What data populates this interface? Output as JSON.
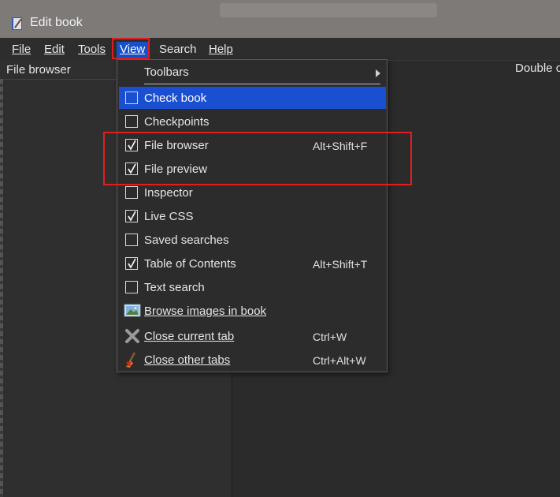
{
  "window": {
    "title": "Edit book"
  },
  "menubar": {
    "file": "File",
    "edit": "Edit",
    "tools": "Tools",
    "view": "View",
    "search": "Search",
    "help": "Help"
  },
  "panels": {
    "left_title": "File browser",
    "right_title": "Double c"
  },
  "view_menu": {
    "toolbars": "Toolbars",
    "items": [
      {
        "label": "Check book",
        "checked": false,
        "shortcut": ""
      },
      {
        "label": "Checkpoints",
        "checked": false,
        "shortcut": ""
      },
      {
        "label": "File browser",
        "checked": true,
        "shortcut": "Alt+Shift+F"
      },
      {
        "label": "File preview",
        "checked": true,
        "shortcut": ""
      },
      {
        "label": "Inspector",
        "checked": false,
        "shortcut": ""
      },
      {
        "label": "Live CSS",
        "checked": true,
        "shortcut": ""
      },
      {
        "label": "Saved searches",
        "checked": false,
        "shortcut": ""
      },
      {
        "label": "Table of Contents",
        "checked": true,
        "shortcut": "Alt+Shift+T"
      },
      {
        "label": "Text search",
        "checked": false,
        "shortcut": ""
      }
    ],
    "browse_images": "Browse images in book",
    "close_current": "Close current tab",
    "close_current_shortcut": "Ctrl+W",
    "close_other": "Close other tabs",
    "close_other_shortcut": "Ctrl+Alt+W"
  },
  "colors": {
    "accent": "#1a4fd1",
    "highlight_box": "#e01e1e",
    "titlebar": "#7d7a78"
  }
}
